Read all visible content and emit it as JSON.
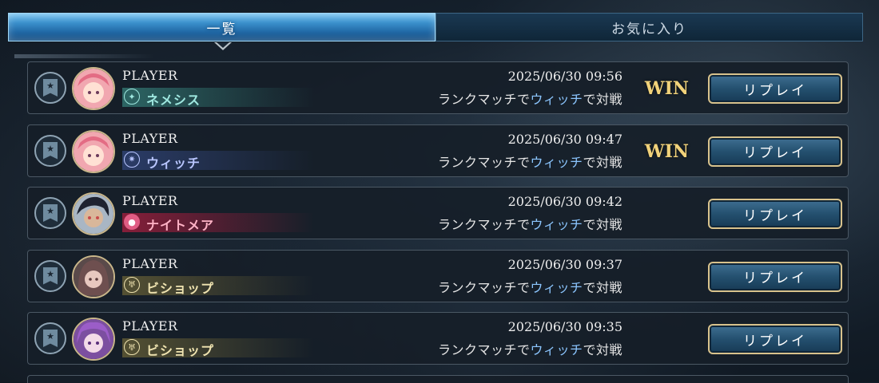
{
  "tabs": [
    {
      "label": "一覧",
      "active": true
    },
    {
      "label": "お気に入り",
      "active": false
    }
  ],
  "rows": [
    {
      "player": "PLAYER",
      "class_name": "ネメシス",
      "class_color": "#9fe8e0",
      "class_bar": "#2f6d6a",
      "date": "2025/06/30 09:56",
      "desc_pre": "ランクマッチで",
      "desc_hl": "ウィッチ",
      "desc_post": "で対戦",
      "result": "WIN",
      "replay": "リプレイ",
      "avatar_icon": "pink-hair-avatar-icon"
    },
    {
      "player": "PLAYER",
      "class_name": "ウィッチ",
      "class_color": "#b9c6ff",
      "class_bar": "#2d3f6e",
      "date": "2025/06/30 09:47",
      "desc_pre": "ランクマッチで",
      "desc_hl": "ウィッチ",
      "desc_post": "で対戦",
      "result": "WIN",
      "replay": "リプレイ",
      "avatar_icon": "pink-hair-avatar-icon"
    },
    {
      "player": "PLAYER",
      "class_name": "ナイトメア",
      "class_color": "#ffb3c6",
      "class_bar": "#7a1f35",
      "date": "2025/06/30 09:42",
      "desc_pre": "ランクマッチで",
      "desc_hl": "ウィッチ",
      "desc_post": "で対戦",
      "result": "",
      "replay": "リプレイ",
      "avatar_icon": "dark-hair-avatar-icon"
    },
    {
      "player": "PLAYER",
      "class_name": "ビショップ",
      "class_color": "#efe3b0",
      "class_bar": "#5b5634",
      "date": "2025/06/30 09:37",
      "desc_pre": "ランクマッチで",
      "desc_hl": "ウィッチ",
      "desc_post": "で対戦",
      "result": "",
      "replay": "リプレイ",
      "avatar_icon": "hooded-avatar-icon"
    },
    {
      "player": "PLAYER",
      "class_name": "ビショップ",
      "class_color": "#efe3b0",
      "class_bar": "#5b5634",
      "date": "2025/06/30 09:35",
      "desc_pre": "ランクマッチで",
      "desc_hl": "ウィッチ",
      "desc_post": "で対戦",
      "result": "",
      "replay": "リプレイ",
      "avatar_icon": "purple-hair-avatar-icon"
    }
  ],
  "icons": {
    "favorite": "star-bookmark-icon",
    "nemesis": "nemesis-class-icon",
    "witch": "witch-class-icon",
    "nightmare": "nightmare-class-icon",
    "bishop": "bishop-class-icon"
  }
}
